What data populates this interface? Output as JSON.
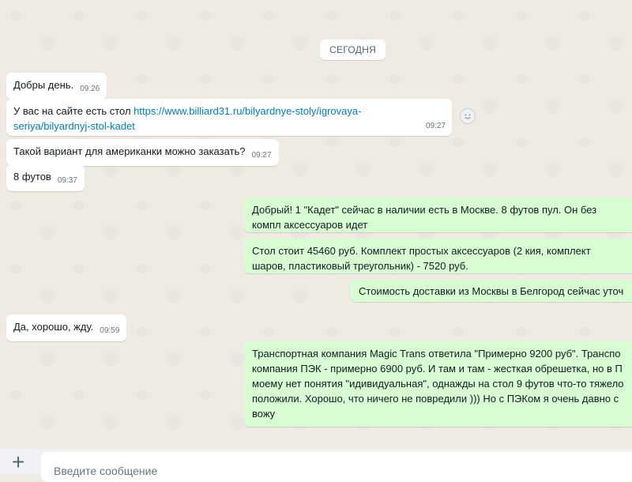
{
  "date_label": "СЕГОДНЯ",
  "messages": [
    {
      "text": "Добры день.",
      "time": "09:26"
    },
    {
      "text_before_link": "У вас на сайте есть стол ",
      "link": "https://www.billiard31.ru/bilyardnye-stoly/igrovaya-seriya/bilyardnyj-stol-kadet",
      "time": "09:27"
    },
    {
      "text": "Такой вариант для американки можно заказать?",
      "time": "09:27"
    },
    {
      "text": "8 футов",
      "time": "09:37"
    },
    {
      "text": "Добрый! 1 \"Кадет\" сейчас в наличии есть в Москве. 8 футов пул. Он без компл аксессуаров идет"
    },
    {
      "text": "Стол стоит 45460 руб. Комплект простых аксессуаров (2 кия, комплект шаров, пластиковый треугольник) - 7520 руб."
    },
    {
      "text": "Стоимость доставки из Москвы в Белгород сейчас уточ"
    },
    {
      "text": "Да, хорошо, жду.",
      "time": "09:59"
    },
    {
      "text": "Транспортная компания Magic Trans ответила \"Примерно 9200 руб\". Транспо компания ПЭК - примерно 6900 руб. И там и там - жесткая обрешетка, но в П моему нет понятия \"идивидуальная\", однажды на стол 9 футов что-то тяжело положили. Хорошо, что ничего не повредили ))) Но с ПЭКом я очень давно с вожу"
    }
  ],
  "composer": {
    "placeholder": "Введите сообщение"
  },
  "icons": {
    "emoji": "smiley-icon",
    "attach": "plus-icon"
  }
}
